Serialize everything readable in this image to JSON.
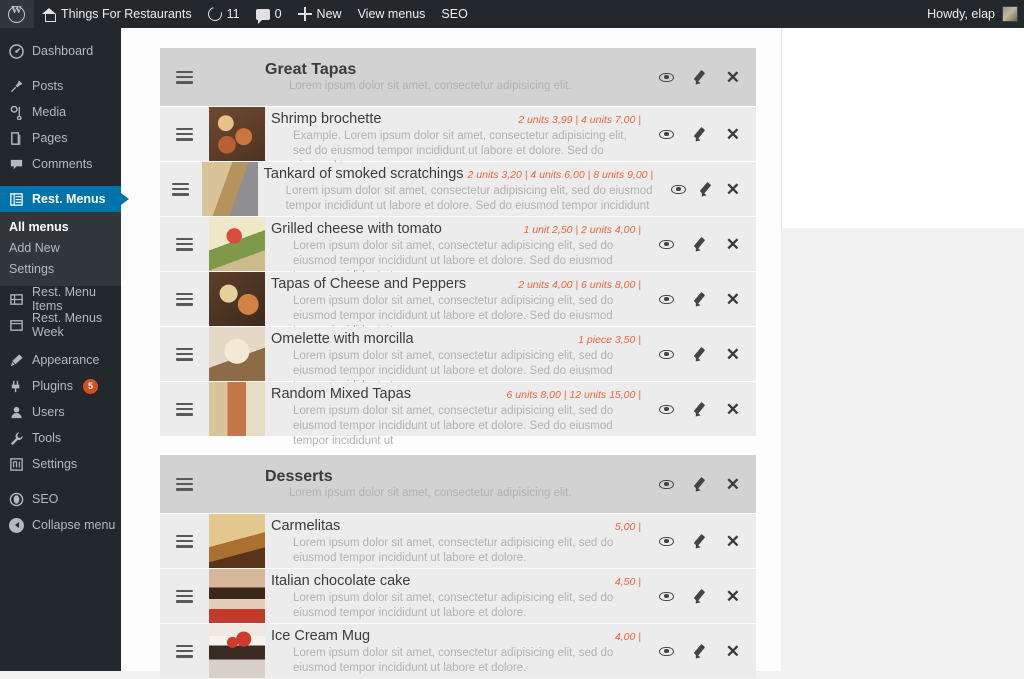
{
  "adminbar": {
    "logo_icon": "wordpress-logo-icon",
    "site_name": "Things For Restaurants",
    "home_icon": "home-icon",
    "updates_icon": "refresh-icon",
    "updates_count": "11",
    "comments_icon": "comment-icon",
    "comments_count": "0",
    "new_icon": "plus-icon",
    "new_label": "New",
    "view_menus_label": "View menus",
    "seo_label": "SEO",
    "howdy": "Howdy, elap",
    "avatar_icon": "avatar"
  },
  "sidebar": {
    "items": [
      {
        "label": "Dashboard",
        "icon": "dashboard-icon",
        "glyph": "◔"
      },
      {
        "label": "Posts",
        "icon": "pin-icon",
        "glyph": "✒"
      },
      {
        "label": "Media",
        "icon": "media-icon",
        "glyph": "♪"
      },
      {
        "label": "Pages",
        "icon": "pages-icon",
        "glyph": "❏"
      },
      {
        "label": "Comments",
        "icon": "comment-icon",
        "glyph": "🗩"
      },
      {
        "label": "Rest. Menus",
        "icon": "menu-list-icon",
        "glyph": "▤",
        "current": true
      },
      {
        "label": "Rest. Menu Items",
        "icon": "menu-items-icon",
        "glyph": "▤"
      },
      {
        "label": "Rest. Menus Week",
        "icon": "menu-week-icon",
        "glyph": "▤"
      },
      {
        "label": "Appearance",
        "icon": "brush-icon",
        "glyph": "✎"
      },
      {
        "label": "Plugins",
        "icon": "plug-icon",
        "glyph": "⚲",
        "badge": "5"
      },
      {
        "label": "Users",
        "icon": "user-icon",
        "glyph": "👤"
      },
      {
        "label": "Tools",
        "icon": "wrench-icon",
        "glyph": "🔧"
      },
      {
        "label": "Settings",
        "icon": "settings-icon",
        "glyph": "⚙"
      },
      {
        "label": "SEO",
        "icon": "seo-icon",
        "glyph": "◉"
      },
      {
        "label": "Collapse menu",
        "icon": "collapse-icon",
        "glyph": "◀"
      }
    ],
    "submenu": [
      {
        "label": "All menus",
        "active": true
      },
      {
        "label": "Add New",
        "active": false
      },
      {
        "label": "Settings",
        "active": false
      }
    ]
  },
  "actions": {
    "view_icon": "eye-icon",
    "edit_icon": "pencil-icon",
    "delete_icon": "close-icon",
    "drag_icon": "drag-handle-icon"
  },
  "colors": {
    "accent_price": "#f1643c",
    "admin_blue": "#0073aa",
    "admin_dark": "#23282d",
    "badge_orange": "#d54e21"
  },
  "menus": [
    {
      "title": "Great Tapas",
      "description": "Lorem ipsum dolor sit amet, consectetur adipisicing elit.",
      "items": [
        {
          "title": "Shrimp brochette",
          "prices": "2 units 3,99 | 4 units 7,00 |",
          "description": "Example. Lorem ipsum dolor sit amet, consectetur adipisicing elit, sed do eiusmod tempor incididunt ut labore et dolore. Sed do eiusmod tempor",
          "thumb": "shrimp-brochette-photo"
        },
        {
          "title": "Tankard of smoked scratchings",
          "prices": "2 units 3,20 | 4 units 6,00 | 8 units 9,00 |",
          "description": "Lorem ipsum dolor sit amet, consectetur adipisicing elit, sed do eiusmod tempor incididunt ut labore et dolore. Sed do eiusmod tempor incididunt ut",
          "thumb": "smoked-scratchings-photo"
        },
        {
          "title": "Grilled cheese with tomato",
          "prices": "1 unit 2,50 | 2 units 4,00 |",
          "description": "Lorem ipsum dolor sit amet, consectetur adipisicing elit, sed do eiusmod tempor incididunt ut labore et dolore. Sed do eiusmod tempor incididunt ut",
          "thumb": "grilled-cheese-photo"
        },
        {
          "title": "Tapas of Cheese and Peppers",
          "prices": "2 units 4,00 | 6 units 8,00 |",
          "description": "Lorem ipsum dolor sit amet, consectetur adipisicing elit, sed do eiusmod tempor incididunt ut labore et dolore. Sed do eiusmod tempor incididunt ut",
          "thumb": "cheese-and-peppers-photo"
        },
        {
          "title": "Omelette with morcilla",
          "prices": "1 piece 3,50 |",
          "description": "Lorem ipsum dolor sit amet, consectetur adipisicing elit, sed do eiusmod tempor incididunt ut labore et dolore. Sed do eiusmod tempor incididunt ut",
          "thumb": "omelette-morcilla-photo"
        },
        {
          "title": "Random Mixed Tapas",
          "prices": "6 units 8,00 | 12 units 15,00 |",
          "description": "Lorem ipsum dolor sit amet, consectetur adipisicing elit, sed do eiusmod tempor incididunt ut labore et dolore. Sed do eiusmod tempor incididunt ut",
          "thumb": "mixed-tapas-photo"
        }
      ]
    },
    {
      "title": "Desserts",
      "description": "Lorem ipsum dolor sit amet, consectetur adipisicing elit.",
      "items": [
        {
          "title": "Carmelitas",
          "prices": "5,00 |",
          "description": "Lorem ipsum dolor sit amet, consectetur adipisicing elit, sed do eiusmod tempor incididunt ut labore et dolore.",
          "thumb": "carmelitas-photo"
        },
        {
          "title": "Italian chocolate cake",
          "prices": "4,50 |",
          "description": "Lorem ipsum dolor sit amet, consectetur adipisicing elit, sed do eiusmod tempor incididunt ut labore et dolore.",
          "thumb": "italian-chocolate-cake-photo"
        },
        {
          "title": "Ice Cream Mug",
          "prices": "4,00 |",
          "description": "Lorem ipsum dolor sit amet, consectetur adipisicing elit, sed do eiusmod tempor incididunt ut labore et dolore.",
          "thumb": "ice-cream-mug-photo"
        }
      ]
    }
  ]
}
